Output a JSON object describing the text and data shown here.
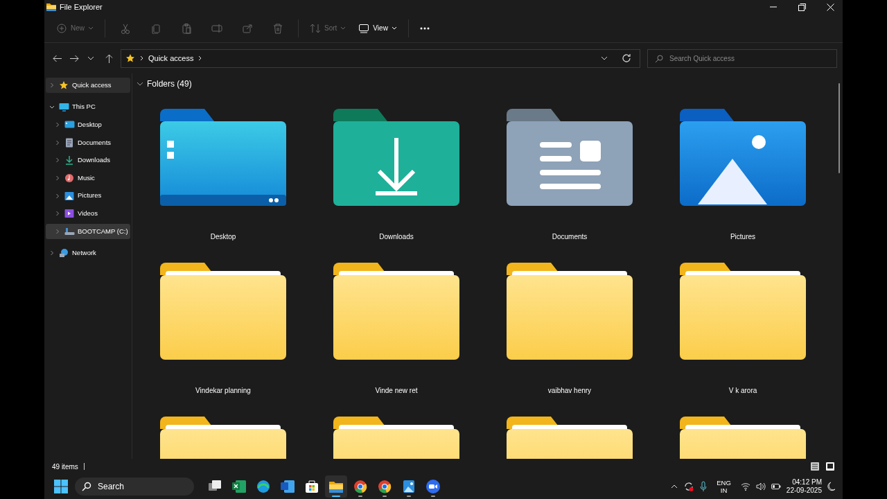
{
  "window": {
    "title": "File Explorer"
  },
  "toolbar": [
    {
      "kind": "new",
      "label": "New",
      "disabled": true,
      "dropdown": true
    },
    {
      "kind": "cut",
      "disabled": true
    },
    {
      "kind": "copy",
      "disabled": true
    },
    {
      "kind": "paste",
      "disabled": true
    },
    {
      "kind": "rename",
      "disabled": true
    },
    {
      "kind": "share",
      "disabled": true
    },
    {
      "kind": "delete",
      "disabled": true
    },
    {
      "kind": "sort",
      "label": "Sort",
      "disabled": true,
      "dropdown": true
    },
    {
      "kind": "view",
      "label": "View",
      "disabled": false,
      "dropdown": true
    },
    {
      "kind": "more",
      "disabled": false
    }
  ],
  "address": {
    "crumbs": [
      "Quick access"
    ],
    "search_placeholder": "Search Quick access"
  },
  "sidebar": {
    "items": [
      {
        "label": "Quick access",
        "kind": "star",
        "expanded": false,
        "selected": true,
        "hovered": false
      },
      {
        "label": "This PC",
        "kind": "pc",
        "expanded": true,
        "selected": false,
        "hovered": false,
        "children": [
          {
            "label": "Desktop",
            "kind": "desktop",
            "expanded": false,
            "selected": false,
            "hovered": false
          },
          {
            "label": "Documents",
            "kind": "documents",
            "expanded": false,
            "selected": false,
            "hovered": false
          },
          {
            "label": "Downloads",
            "kind": "downloads",
            "expanded": false,
            "selected": false,
            "hovered": false
          },
          {
            "label": "Music",
            "kind": "music",
            "expanded": false,
            "selected": false,
            "hovered": false
          },
          {
            "label": "Pictures",
            "kind": "pictures",
            "expanded": false,
            "selected": false,
            "hovered": false
          },
          {
            "label": "Videos",
            "kind": "videos",
            "expanded": false,
            "selected": false,
            "hovered": false
          },
          {
            "label": "BOOTCAMP (C:)",
            "kind": "drive",
            "expanded": false,
            "selected": false,
            "hovered": true
          }
        ]
      },
      {
        "label": "Network",
        "kind": "network",
        "expanded": false,
        "selected": false,
        "hovered": false
      }
    ]
  },
  "section": {
    "title": "Folders (49)",
    "expanded": true
  },
  "folders": [
    {
      "kind": "desktop",
      "name": "Desktop"
    },
    {
      "kind": "downloads",
      "name": "Downloads"
    },
    {
      "kind": "documents",
      "name": "Documents"
    },
    {
      "kind": "pictures",
      "name": "Pictures"
    },
    {
      "kind": "plain",
      "name": "Vindekar planning"
    },
    {
      "kind": "plain",
      "name": "Vinde new ret"
    },
    {
      "kind": "plain",
      "name": "vaibhav henry"
    },
    {
      "kind": "plain",
      "name": "V k arora"
    },
    {
      "kind": "plain"
    },
    {
      "kind": "plain"
    },
    {
      "kind": "plain"
    },
    {
      "kind": "plain"
    }
  ],
  "status_bar": {
    "count": "49 items"
  },
  "taskbar": {
    "search": "Search",
    "apps": [
      {
        "kind": "taskview",
        "running": false,
        "active": false
      },
      {
        "kind": "excel",
        "running": false,
        "active": false
      },
      {
        "kind": "edge",
        "running": false,
        "active": false
      },
      {
        "kind": "word",
        "running": false,
        "active": false
      },
      {
        "kind": "store",
        "running": false,
        "active": false
      },
      {
        "kind": "explorer",
        "running": true,
        "active": true
      },
      {
        "kind": "chrome",
        "running": true,
        "active": false
      },
      {
        "kind": "chrome",
        "running": true,
        "active": false
      },
      {
        "kind": "photos",
        "running": true,
        "active": false
      },
      {
        "kind": "zoom",
        "running": true,
        "active": false
      }
    ],
    "language": [
      "ENG",
      "IN"
    ],
    "time": "04:12 PM",
    "date": "22-09-2025"
  }
}
